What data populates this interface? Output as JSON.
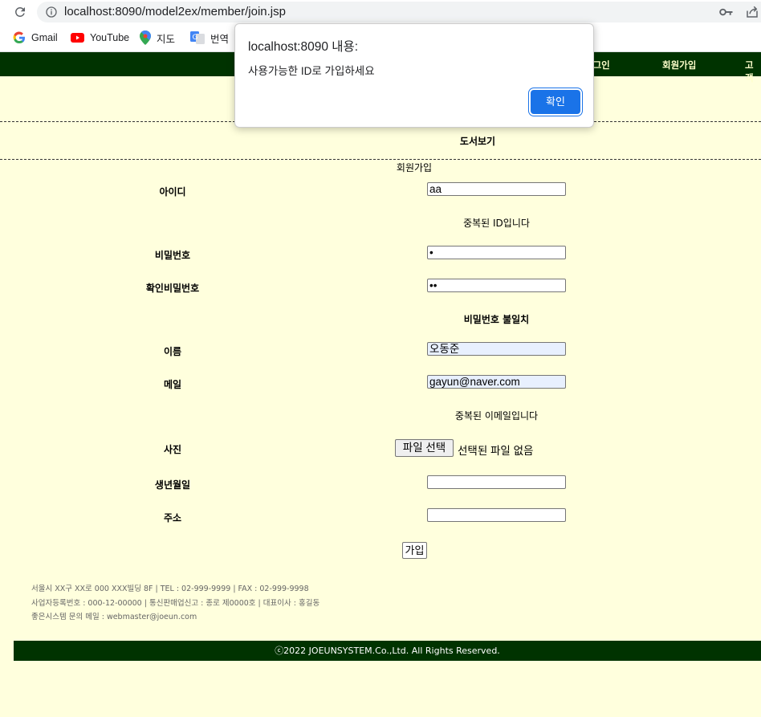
{
  "browser": {
    "url": "localhost:8090/model2ex/member/join.jsp",
    "bookmarks": [
      {
        "label": "Gmail"
      },
      {
        "label": "YouTube"
      },
      {
        "label": "지도"
      },
      {
        "label": "번역"
      }
    ]
  },
  "nav": {
    "login": "로그인",
    "join": "회원가입",
    "customer": "고객"
  },
  "menu_title": "도서보기",
  "form": {
    "caption": "회원가입",
    "id_label": "아이디",
    "id_value": "aa",
    "id_msg": "중복된 ID입니다",
    "pw_label": "비밀번호",
    "pw_value": "•",
    "pw_confirm_label": "확인비밀번호",
    "pw_confirm_value": "••",
    "pw_msg": "비밀번호 불일치",
    "name_label": "이름",
    "name_value": "오동준",
    "email_label": "메일",
    "email_value": "gayun@naver.com",
    "email_msg": "중복된 이메일입니다",
    "photo_label": "사진",
    "file_button": "파일 선택",
    "file_none": "선택된 파일 없음",
    "birth_label": "생년월일",
    "birth_value": "",
    "address_label": "주소",
    "address_value": "",
    "submit": "가입"
  },
  "footer": {
    "line1": "서울시 XX구 XX로 000 XXX빌딩 8F | TEL : 02-999-9999 | FAX : 02-999-9998",
    "line2": "사업자등록번호 : 000-12-00000 | 통신판매업신고 : 종로 제0000호 | 대표이사 : 홍길동",
    "line3": "좋은시스템 문의 메일 : webmaster@joeun.com",
    "copyright": "ⓒ2022 JOEUNSYSTEM.Co.,Ltd. All Rights Reserved."
  },
  "alert": {
    "title": "localhost:8090 내용:",
    "message": "사용가능한 ID로 가입하세요",
    "ok": "확인"
  },
  "colors": {
    "page_bg": "#ffffdd",
    "nav_bg": "#003300",
    "accent": "#1a73e8"
  }
}
